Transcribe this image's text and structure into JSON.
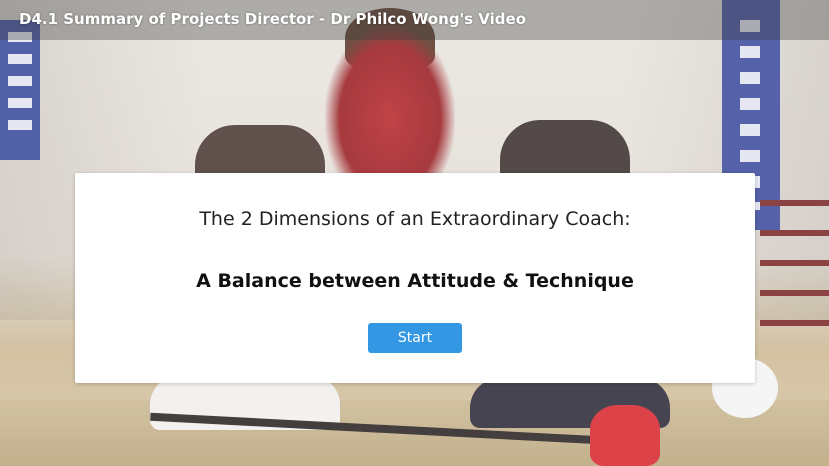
{
  "window": {
    "title": "D4.1 Summary of Projects Director - Dr Philco Wong's Video"
  },
  "intro": {
    "heading": "The 2 Dimensions of an Extraordinary Coach:",
    "subheading": "A Balance between Attitude & Technique",
    "start_label": "Start"
  },
  "colors": {
    "accent": "#3497e4",
    "card_bg": "#ffffff",
    "title_text": "#ffffff"
  }
}
